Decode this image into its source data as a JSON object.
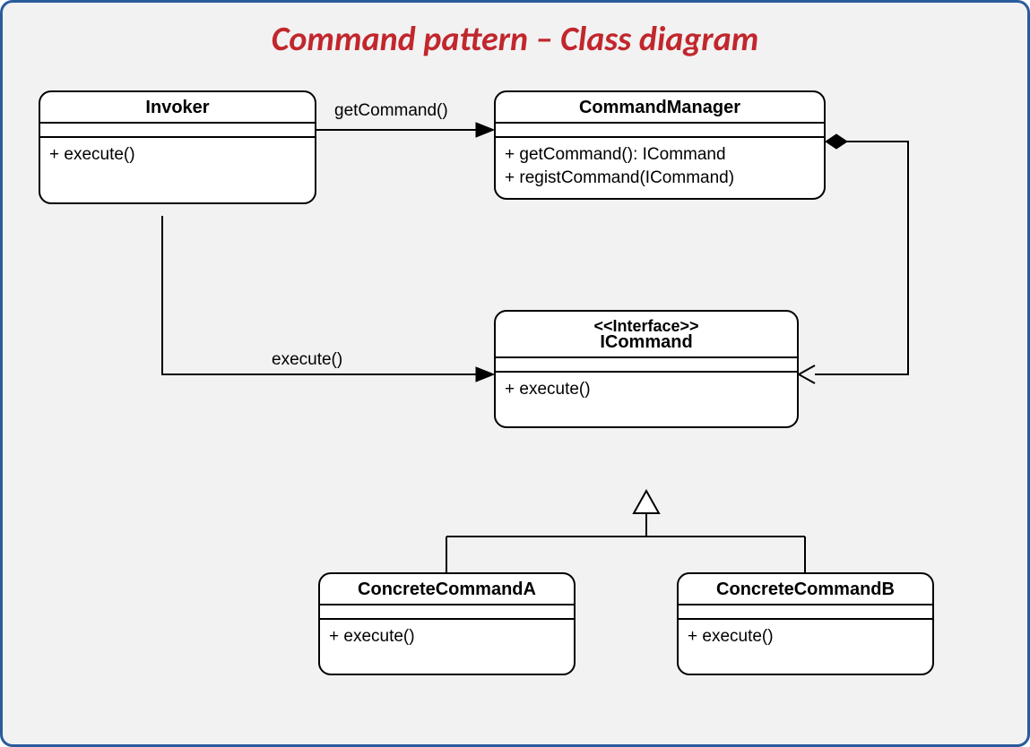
{
  "title": "Command pattern – Class diagram",
  "classes": {
    "invoker": {
      "name": "Invoker",
      "methods": [
        "+ execute()"
      ]
    },
    "commandManager": {
      "name": "CommandManager",
      "methods": [
        "+ getCommand(): ICommand",
        "+ registCommand(ICommand)"
      ]
    },
    "iCommand": {
      "stereotype": "<<Interface>>",
      "name": "ICommand",
      "methods": [
        "+ execute()"
      ]
    },
    "concreteA": {
      "name": "ConcreteCommandA",
      "methods": [
        "+ execute()"
      ]
    },
    "concreteB": {
      "name": "ConcreteCommandB",
      "methods": [
        "+ execute()"
      ]
    }
  },
  "relations": {
    "invokerToManager": {
      "label": "getCommand()"
    },
    "invokerToICommand": {
      "label": "execute()"
    }
  }
}
